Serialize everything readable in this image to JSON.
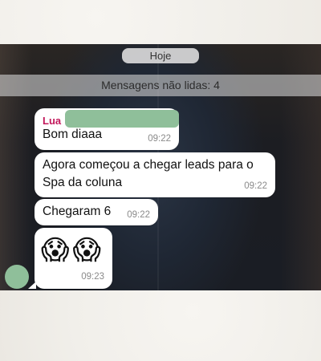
{
  "date_separator": "Hoje",
  "unread_banner": "Mensagens não lidas: 4",
  "messages": [
    {
      "sender": "Lua",
      "text": "Bom diaaa",
      "time": "09:22"
    },
    {
      "text": "Agora começou a chegar leads para o Spa da coluna",
      "time": "09:22"
    },
    {
      "text": "Chegaram 6",
      "time": "09:22"
    },
    {
      "emoji": [
        "😱",
        "😱"
      ],
      "time": "09:23"
    }
  ],
  "colors": {
    "sender_name": "#c2185b",
    "bubble": "#ffffff",
    "redaction": "#8fbf9a",
    "avatar": "#8fbf9a"
  }
}
